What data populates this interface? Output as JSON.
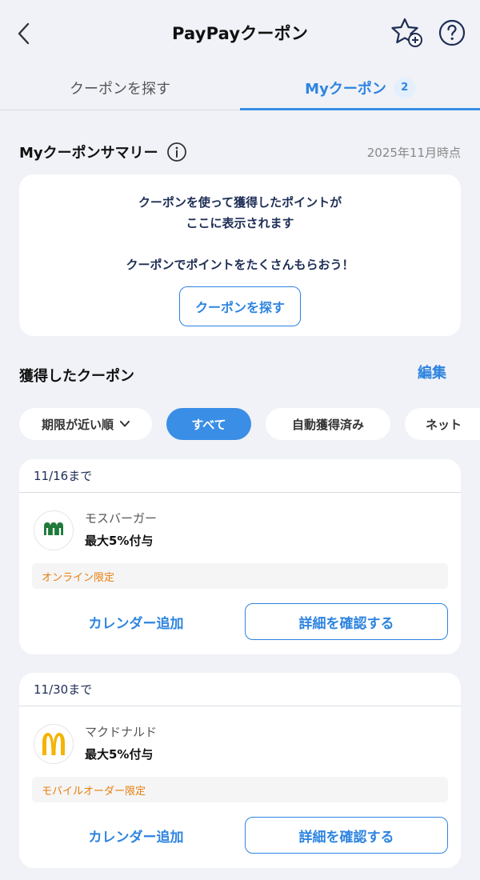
{
  "header": {
    "title": "PayPayクーポン"
  },
  "tabs": [
    {
      "label": "クーポンを探す",
      "active": false
    },
    {
      "label": "Myクーポン",
      "active": true,
      "badge": "2"
    }
  ],
  "summary": {
    "title": "Myクーポンサマリー",
    "as_of": "2025年11月時点",
    "lines": [
      "クーポンを使って獲得したポイントが",
      "ここに表示されます",
      "クーポンでポイントをたくさんもらおう！"
    ],
    "button_label": "クーポンを探す"
  },
  "obtained": {
    "title": "獲得したクーポン",
    "edit_label": "編集"
  },
  "filters": {
    "sort_label": "期限が近い順",
    "chips": [
      {
        "label": "すべて",
        "selected": true
      },
      {
        "label": "自動獲得済み",
        "selected": false
      },
      {
        "label": "ネット",
        "selected": false
      }
    ]
  },
  "coupons": [
    {
      "deadline": "11/16まで",
      "store": "モスバーガー",
      "benefit": "最大5%付与",
      "limit": "オンライン限定",
      "logo_text": "MOS BURGER",
      "calendar_label": "カレンダー追加",
      "detail_label": "詳細を確認する"
    },
    {
      "deadline": "11/30まで",
      "store": "マクドナルド",
      "benefit": "最大5%付与",
      "limit": "モバイルオーダー限定",
      "calendar_label": "カレンダー追加",
      "detail_label": "詳細を確認する"
    }
  ],
  "colors": {
    "accent": "#3a8ee6",
    "navy_text": "#1d2d55",
    "orange_tag": "#e87d0d",
    "background": "#f0f2f7"
  },
  "icons": {
    "back": "chevron-left-icon",
    "favorite": "star-plus-icon",
    "help": "question-circle-icon",
    "info": "info-circle-icon",
    "sort": "chevron-down-icon"
  }
}
